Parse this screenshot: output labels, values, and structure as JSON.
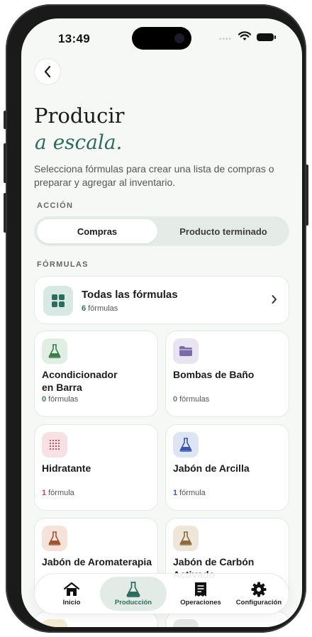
{
  "status_bar": {
    "time": "13:49"
  },
  "header": {
    "title": "Producir",
    "title_accent": "a escala.",
    "description": "Selecciona fórmulas para crear una lista de compras o preparar y agregar al inventario."
  },
  "action": {
    "section_label": "ACCIÓN",
    "options": [
      "Compras",
      "Producto terminado"
    ],
    "selected": "Compras"
  },
  "formulas": {
    "section_label": "FÓRMULAS",
    "all": {
      "name": "Todas las fórmulas",
      "count": "6",
      "unit": "fórmulas"
    },
    "categories": [
      {
        "name": "Acondicionador en Barra",
        "line1": "Acondicionador",
        "line2": "en Barra",
        "count": "0",
        "unit": "fórmulas",
        "icon": "flask-icon",
        "color": "#3f7a4f",
        "bg": "#e1eee4"
      },
      {
        "name": "Bombas de Baño",
        "line1": "Bombas de Baño",
        "line2": "",
        "count": "0",
        "unit": "fórmulas",
        "icon": "folder-icon",
        "color": "#7a6aa8",
        "bg": "#e8e4f2"
      },
      {
        "name": "Hidratante",
        "line1": "Hidratante",
        "line2": "",
        "count": "1",
        "unit": "fórmula",
        "icon": "dots-icon",
        "color": "#c0435a",
        "bg": "#f7e1e4"
      },
      {
        "name": "Jabón de Arcilla",
        "line1": "Jabón de Arcilla",
        "line2": "",
        "count": "1",
        "unit": "fórmula",
        "icon": "flask-icon",
        "color": "#3d58a8",
        "bg": "#dde5f3"
      },
      {
        "name": "Jabón de Aromaterapia",
        "line1": "Jabón de Aromaterapia",
        "line2": "",
        "icon": "flask-icon",
        "color": "#a0542f",
        "bg": "#f5e2d8"
      },
      {
        "name": "Jabón de Carbón Activado",
        "line1": "Jabón de Carbón",
        "line2": "Activado",
        "icon": "flask-icon",
        "color": "#8a6a3f",
        "bg": "#efe6da"
      }
    ]
  },
  "tabbar": {
    "items": [
      {
        "label": "Inicio",
        "icon": "home-icon"
      },
      {
        "label": "Producción",
        "icon": "flask-icon"
      },
      {
        "label": "Operaciones",
        "icon": "receipt-icon"
      },
      {
        "label": "Configuración",
        "icon": "gear-icon"
      }
    ],
    "active": "Producción"
  },
  "colors": {
    "accent": "#2e6b5e",
    "background": "#f6f8f6"
  }
}
